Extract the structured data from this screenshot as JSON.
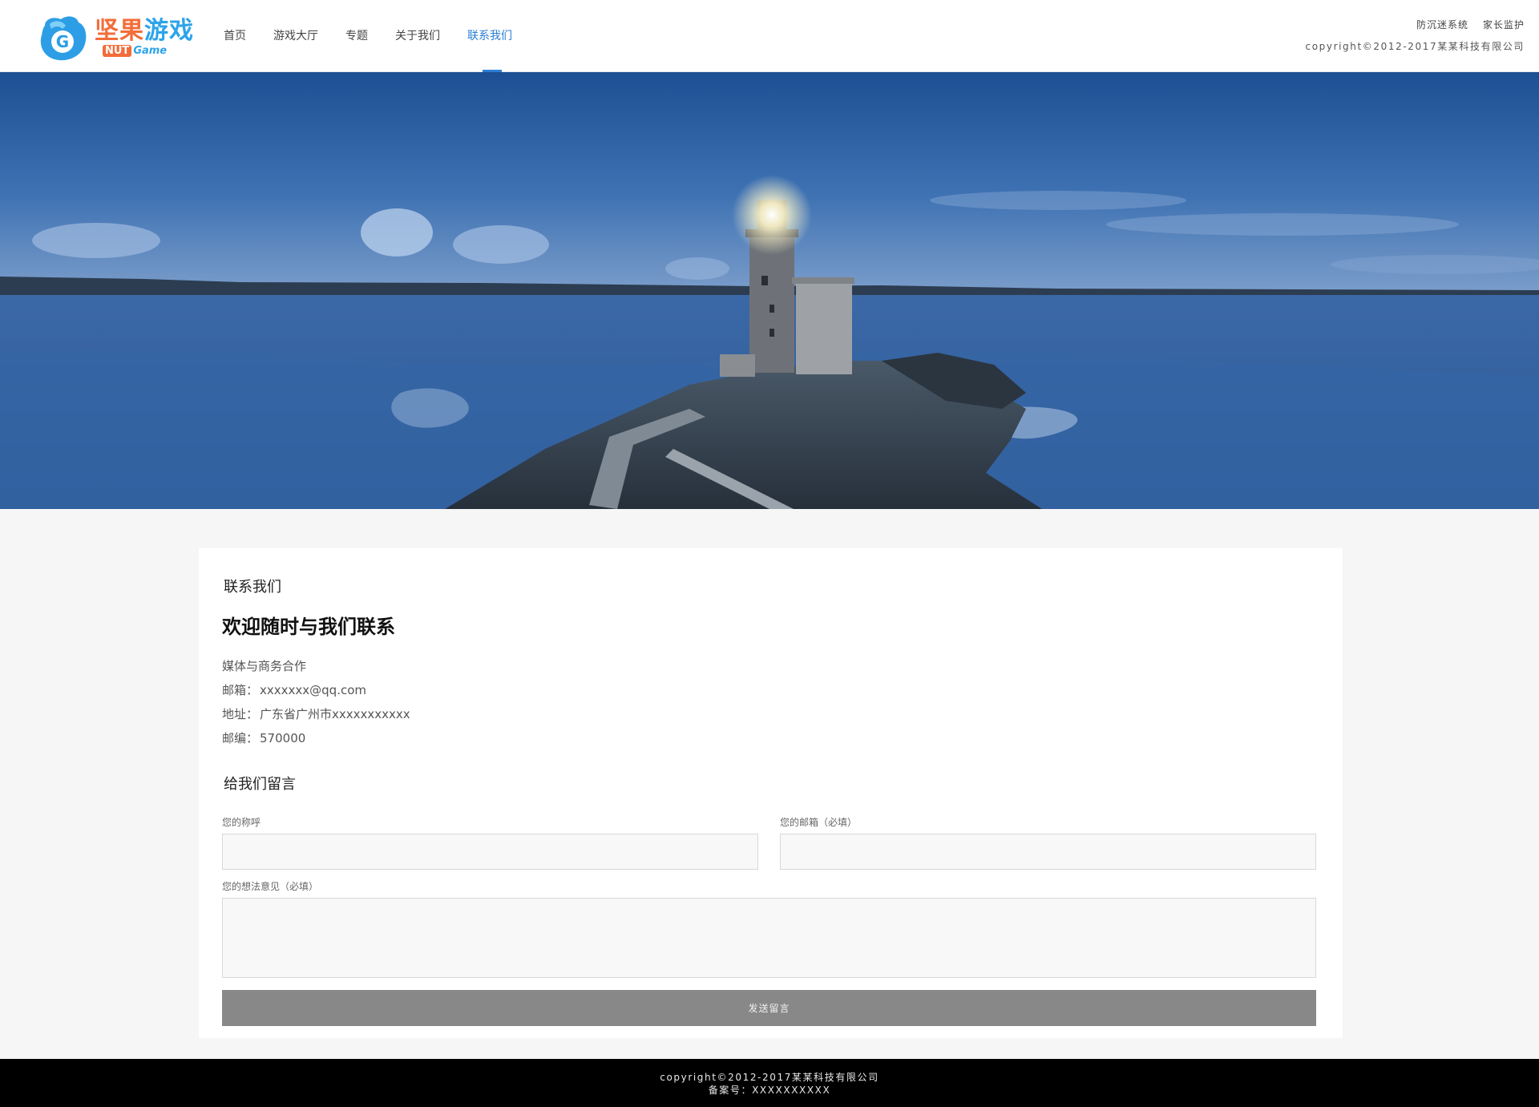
{
  "header": {
    "logo": {
      "cn_part1": "坚果",
      "cn_part2": "游戏",
      "en_part1": "NUT",
      "en_part2": "Game"
    },
    "nav": [
      {
        "label": "首页",
        "active": false
      },
      {
        "label": "游戏大厅",
        "active": false
      },
      {
        "label": "专题",
        "active": false
      },
      {
        "label": "关于我们",
        "active": false
      },
      {
        "label": "联系我们",
        "active": true
      }
    ],
    "links": [
      "防沉迷系统",
      "家长监护"
    ],
    "copyright": "copyright©2012-2017某某科技有限公司"
  },
  "contact": {
    "section_title": "联系我们",
    "headline": "欢迎随时与我们联系",
    "info_heading": "媒体与商务合作",
    "email_label": "邮箱：",
    "email": "xxxxxxx@qq.com",
    "address_label": "地址：",
    "address": "广东省广州市xxxxxxxxxxx",
    "postcode_label": "邮编：",
    "postcode": "570000"
  },
  "form": {
    "title": "给我们留言",
    "name_label": "您的称呼",
    "name_value": "",
    "email_label": "您的邮箱（必填）",
    "email_value": "",
    "message_label": "您的想法意见（必填）",
    "message_value": "",
    "submit_label": "发送留言"
  },
  "footer": {
    "copyright": "copyright©2012-2017某某科技有限公司",
    "icp": "备案号：XXXXXXXXXX"
  },
  "colors": {
    "accent": "#2b7fd4",
    "button": "#888888",
    "footer_bg": "#000000",
    "page_bg": "#f6f6f6"
  }
}
